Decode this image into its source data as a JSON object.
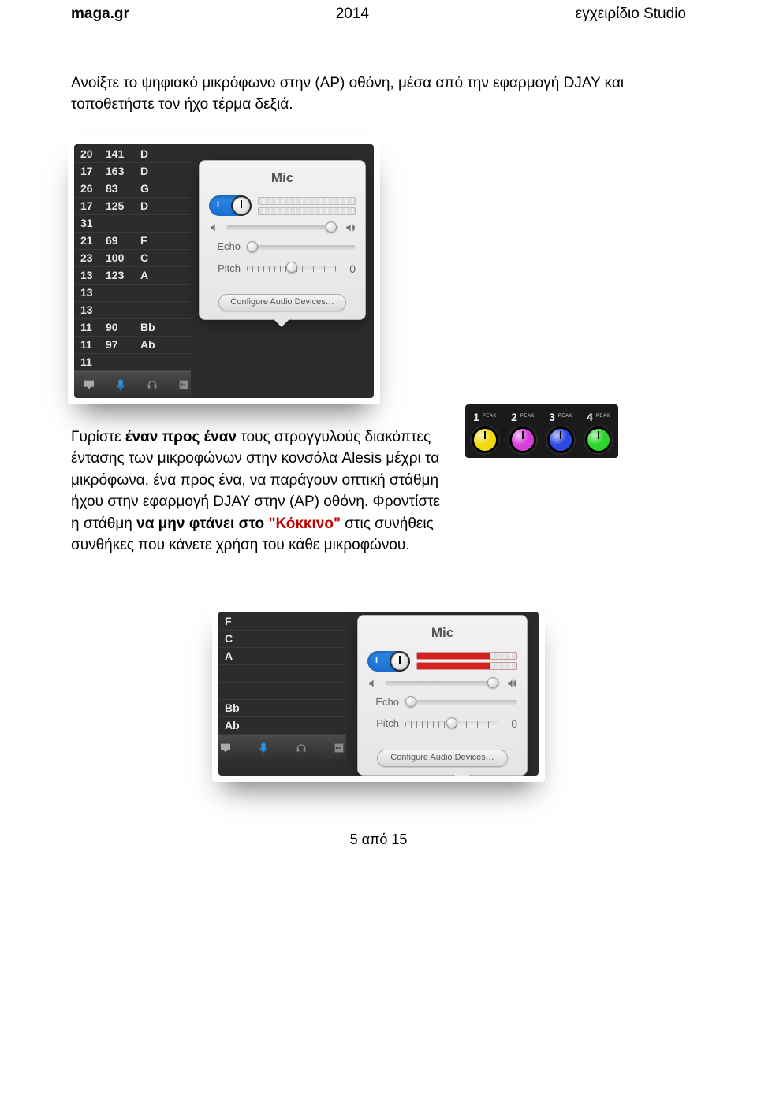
{
  "header": {
    "left": "maga.gr",
    "center": "2014",
    "right": "εγχειρίδιο Studio"
  },
  "para1": "Ανοίξτε το ψηφιακό μικρόφωνο στην (AP) οθόνη, μέσα από την εφαρμογή DJAY και τοποθετήστε τον ήχο τέρμα δεξιά.",
  "para2_parts": {
    "a": "Γυρίστε ",
    "b": "έναν προς έναν",
    "c": " τους στρογγυλούς διακόπτες έντασης των μικροφώνων στην κονσόλα Alesis μέχρι τα μικρόφωνα, ένα προς ένα, να παράγουν οπτική στάθμη ήχου στην εφαρμογή DJAY στην (AP) οθόνη. Φροντίστε η στάθμη ",
    "d": "να μην φτάνει στο ",
    "e": "\"Κόκκινο\"",
    "f": " στις συνήθεις συνθήκες που κάνετε χρήση του κάθε μικροφώνου."
  },
  "footer": "5 από 15",
  "djay": {
    "popover_title": "Mic",
    "echo_label": "Echo",
    "pitch_label": "Pitch",
    "pitch_value": "0",
    "config_label": "Configure Audio Devices…",
    "toggle_glyph": "I",
    "list1": [
      {
        "c1": "20",
        "c2": "141",
        "c3": "D"
      },
      {
        "c1": "17",
        "c2": "163",
        "c3": "D"
      },
      {
        "c1": "26",
        "c2": "83",
        "c3": "G"
      },
      {
        "c1": "17",
        "c2": "125",
        "c3": "D"
      },
      {
        "c1": "31",
        "c2": "",
        "c3": ""
      },
      {
        "c1": "21",
        "c2": "69",
        "c3": "F"
      },
      {
        "c1": "23",
        "c2": "100",
        "c3": "C"
      },
      {
        "c1": "13",
        "c2": "123",
        "c3": "A"
      },
      {
        "c1": "13",
        "c2": "",
        "c3": ""
      },
      {
        "c1": "13",
        "c2": "",
        "c3": ""
      },
      {
        "c1": "11",
        "c2": "90",
        "c3": "Bb"
      },
      {
        "c1": "11",
        "c2": "97",
        "c3": "Ab"
      },
      {
        "c1": "11",
        "c2": "",
        "c3": ""
      }
    ],
    "list2": [
      "F",
      "C",
      "A",
      "",
      "",
      "Bb",
      "Ab"
    ]
  },
  "alesis": {
    "peak": "PEAK",
    "channels": [
      {
        "n": "1",
        "color": "#f2d90a"
      },
      {
        "n": "2",
        "color": "#d83fd8"
      },
      {
        "n": "3",
        "color": "#2a4ae0"
      },
      {
        "n": "4",
        "color": "#2ad62a"
      }
    ]
  }
}
